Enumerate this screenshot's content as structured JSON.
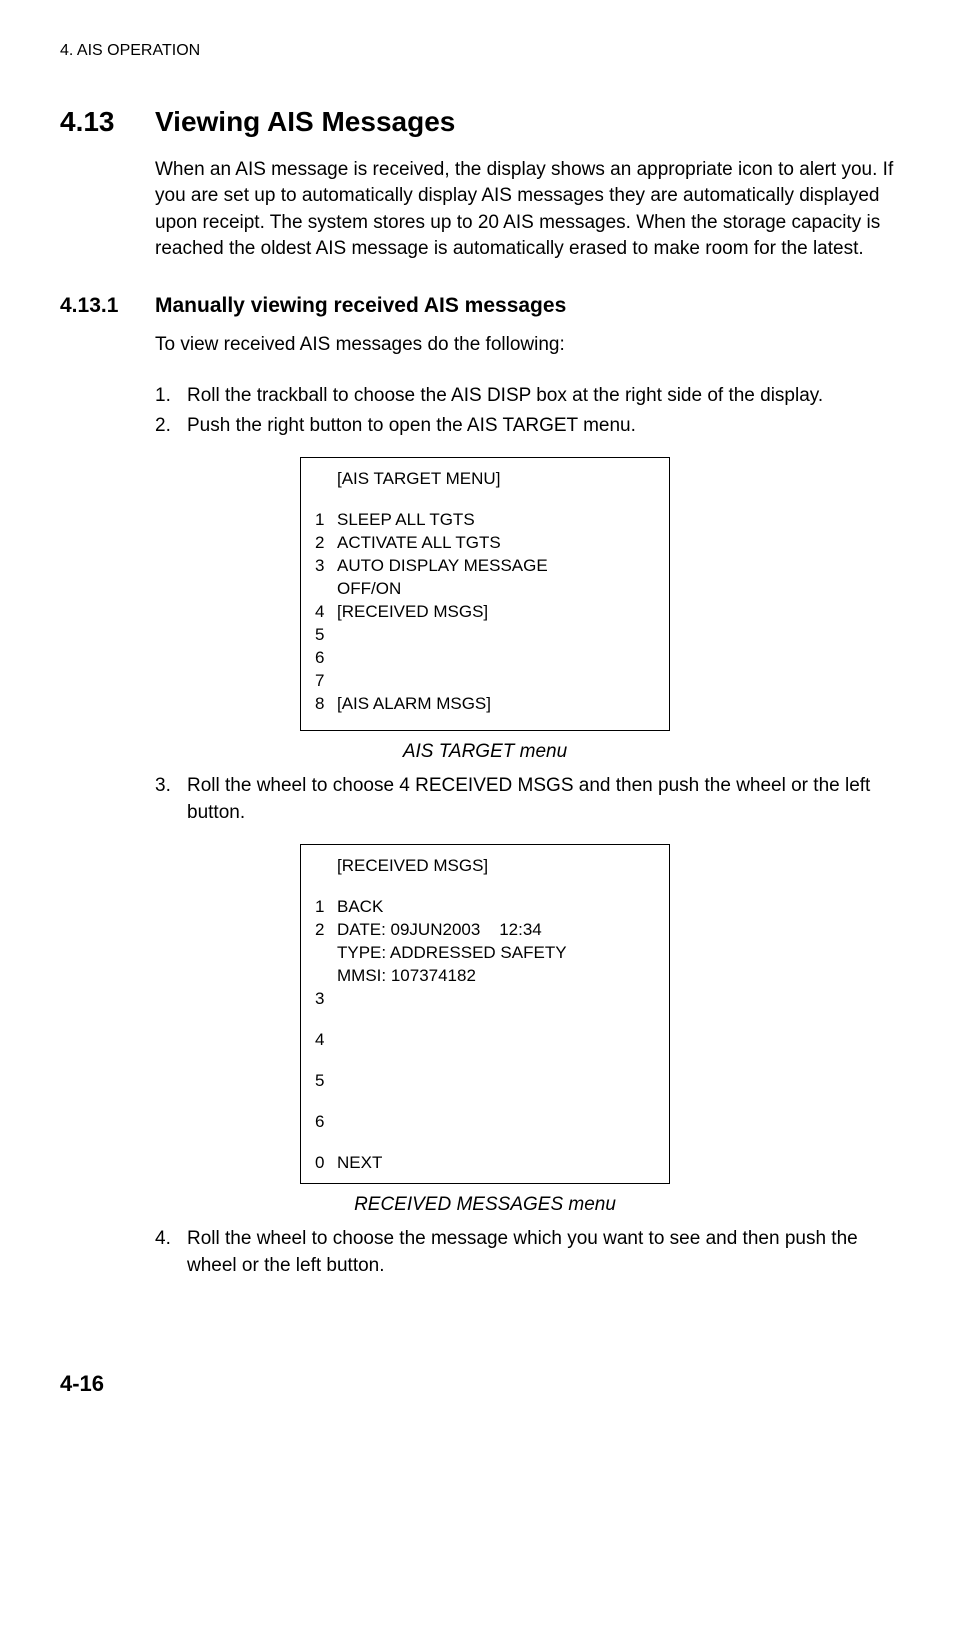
{
  "header": "4. AIS OPERATION",
  "section": {
    "number": "4.13",
    "title": "Viewing AIS Messages",
    "intro": "When an AIS message is received, the display shows an appropriate icon to alert you. If you are set up to automatically display AIS messages they are automatically displayed upon receipt. The system stores up to 20 AIS messages. When the storage capacity is reached the oldest AIS message is automatically erased to make room for the latest."
  },
  "subsection": {
    "number": "4.13.1",
    "title": "Manually viewing received AIS messages",
    "intro": "To view received AIS messages do the following:"
  },
  "steps": {
    "s1n": "1.",
    "s1": "Roll the trackball to choose the AIS DISP box at the right side of the display.",
    "s2n": "2.",
    "s2": "Push the right button to open the AIS TARGET menu.",
    "s3n": "3.",
    "s3": "Roll the wheel to choose 4 RECEIVED MSGS and then push the wheel or the left button.",
    "s4n": "4.",
    "s4": "Roll the wheel to choose the message which you want to see and then push the wheel or the left button."
  },
  "menu1": {
    "title": "[AIS TARGET MENU]",
    "l1n": "1",
    "l1": "SLEEP ALL TGTS",
    "l2n": "2",
    "l2": "ACTIVATE ALL TGTS",
    "l3n": "3",
    "l3": "AUTO DISPLAY MESSAGE",
    "l3b": "OFF/ON",
    "l4n": "4",
    "l4": "[RECEIVED MSGS]",
    "l5n": "5",
    "l6n": "6",
    "l7n": "7",
    "l8n": "8",
    "l8": "[AIS ALARM MSGS]",
    "caption": "AIS TARGET menu"
  },
  "menu2": {
    "title": "[RECEIVED MSGS]",
    "l1n": "1",
    "l1": "BACK",
    "l2n": "2",
    "l2": "DATE: 09JUN2003    12:34",
    "l2b": "TYPE: ADDRESSED SAFETY",
    "l2c": "MMSI: 107374182",
    "l3n": "3",
    "l4n": "4",
    "l5n": "5",
    "l6n": "6",
    "l0n": "0",
    "l0": "NEXT",
    "caption": "RECEIVED MESSAGES menu"
  },
  "pageNumber": "4-16"
}
